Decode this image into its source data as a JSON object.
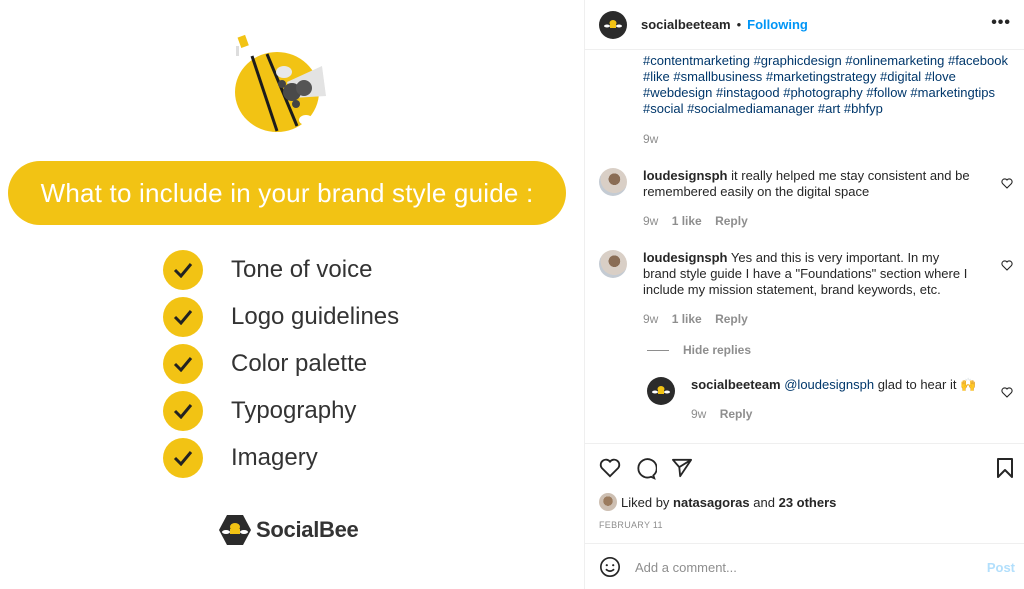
{
  "image": {
    "title": "What to include in your brand style guide :",
    "checklist": [
      "Tone of voice",
      "Logo guidelines",
      "Color palette",
      "Typography",
      "Imagery"
    ],
    "brand_name": "SocialBee",
    "accent_color": "#f2c314"
  },
  "header": {
    "username": "socialbeeteam",
    "separator": "•",
    "follow_status": "Following",
    "more_label": "•••"
  },
  "caption": {
    "hashtags": "#contentmarketing #graphicdesign #onlinemarketing #facebook #like #smallbusiness #marketingstrategy #digital #love #webdesign #instagood #photography #follow #marketingtips #social #socialmediamanager #art #bhfyp",
    "age": "9w"
  },
  "comments": [
    {
      "username": "loudesignsph",
      "text": "it really helped me stay consistent and be remembered easily on the digital space",
      "age": "9w",
      "likes": "1 like",
      "reply": "Reply"
    },
    {
      "username": "loudesignsph",
      "text": "Yes and this is very important. In my brand style guide I have a \"Foundations\" section where I include my mission statement, brand keywords, etc.",
      "age": "9w",
      "likes": "1 like",
      "reply": "Reply"
    }
  ],
  "hide_replies": "Hide replies",
  "reply": {
    "username": "socialbeeteam",
    "mention": "@loudesignsph",
    "text": "glad to hear it 🙌",
    "age": "9w",
    "reply": "Reply"
  },
  "likes": {
    "prefix": "Liked by",
    "user": "natasagoras",
    "middle": "and",
    "others": "23 others"
  },
  "date": "FEBRUARY 11",
  "add_comment": {
    "placeholder": "Add a comment...",
    "post_label": "Post"
  }
}
